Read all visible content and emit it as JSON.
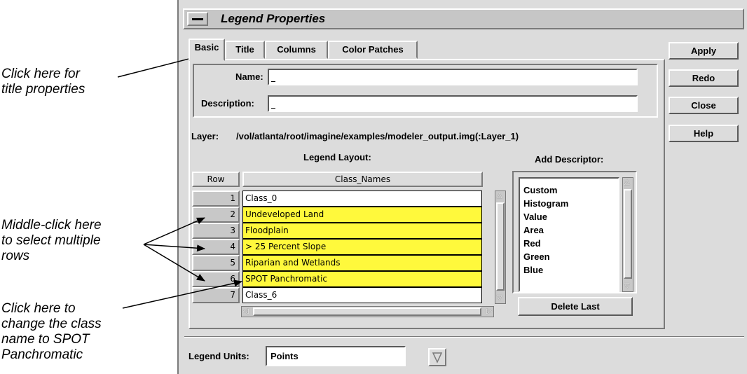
{
  "annotations": {
    "title_tab": "Click here for\ntitle properties",
    "multi_select": "Middle-click here\nto select multiple\nrows",
    "class_name": "Click here to\nchange the class\nname to SPOT\nPanchromatic"
  },
  "window": {
    "title": "Legend Properties"
  },
  "tabs": [
    {
      "label": "Basic",
      "active": true
    },
    {
      "label": "Title",
      "active": false
    },
    {
      "label": "Columns",
      "active": false
    },
    {
      "label": "Color Patches",
      "active": false
    }
  ],
  "buttons": {
    "apply": "Apply",
    "redo": "Redo",
    "close": "Close",
    "help": "Help"
  },
  "form": {
    "name_label": "Name:",
    "name_value": "",
    "description_label": "Description:",
    "description_value": ""
  },
  "layer": {
    "label": "Layer:",
    "path": "/vol/atlanta/root/imagine/examples/modeler_output.img(:Layer_1)"
  },
  "legend_layout": {
    "title": "Legend Layout:",
    "columns": [
      "Row",
      "Class_Names"
    ],
    "rows": [
      {
        "row": "1",
        "name": "Class_0",
        "highlighted": false
      },
      {
        "row": "2",
        "name": "Undeveloped Land",
        "highlighted": true
      },
      {
        "row": "3",
        "name": "Floodplain",
        "highlighted": true
      },
      {
        "row": "4",
        "name": "> 25 Percent Slope",
        "highlighted": true
      },
      {
        "row": "5",
        "name": "Riparian and Wetlands",
        "highlighted": true
      },
      {
        "row": "6",
        "name": "SPOT Panchromatic",
        "highlighted": true
      },
      {
        "row": "7",
        "name": "Class_6",
        "highlighted": false
      }
    ]
  },
  "add_descriptor": {
    "title": "Add Descriptor:",
    "items": [
      "Custom",
      "Histogram",
      "Value",
      "Area",
      "Red",
      "Green",
      "Blue"
    ],
    "delete_label": "Delete Last"
  },
  "legend_units": {
    "label": "Legend Units:",
    "value": "Points"
  },
  "colors": {
    "highlight": "#fff93c",
    "background": "#dcdcdc"
  }
}
